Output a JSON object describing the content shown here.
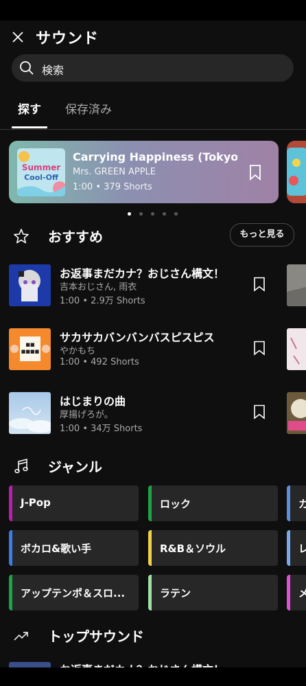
{
  "header": {
    "title": "サウンド"
  },
  "search": {
    "placeholder": "検索"
  },
  "tabs": [
    {
      "label": "探す"
    },
    {
      "label": "保存済み"
    }
  ],
  "featured": {
    "title": "Carrying Happiness (Tokyo Disn...",
    "artist": "Mrs. GREEN APPLE",
    "meta": "1:00 • 379 Shorts",
    "art_text": "Summer Cool-Off"
  },
  "recommended": {
    "title": "おすすめ",
    "more_label": "もっと見る",
    "items": [
      {
        "title": "お返事まだカナ？おじさん構文！",
        "artist": "吉本おじさん, 雨衣",
        "meta": "1:00 • 2.9万 Shorts"
      },
      {
        "title": "サカサカバンバンバスピスピス",
        "artist": "やかもち",
        "meta": "1:00 • 492 Shorts"
      },
      {
        "title": "はじまりの曲",
        "artist": "厚揚げろが。",
        "meta": "1:00 • 34万 Shorts"
      }
    ]
  },
  "genres": {
    "title": "ジャンル",
    "items": [
      {
        "label": "J-Pop",
        "color": "#b61fb2"
      },
      {
        "label": "ロック",
        "color": "#1ea446"
      },
      {
        "label": "カ",
        "color": "#5a8fe0"
      },
      {
        "label": "ボカロ&歌い手",
        "color": "#3b7de8"
      },
      {
        "label": "R&B＆ソウル",
        "color": "#f0d24a"
      },
      {
        "label": "レ",
        "color": "#7aa8ea"
      },
      {
        "label": "アップテンポ＆スロ...",
        "color": "#1ea446"
      },
      {
        "label": "ラテン",
        "color": "#9fe1a3"
      },
      {
        "label": "メ",
        "color": "#e04fd8"
      }
    ]
  },
  "top_sounds": {
    "title": "トップサウンド",
    "first_item_title": "お返事まだカナ？おじさん構文！"
  },
  "colors": {
    "background": "#0f0f0f",
    "surface": "#272727",
    "text_secondary": "#aaaaaa"
  }
}
